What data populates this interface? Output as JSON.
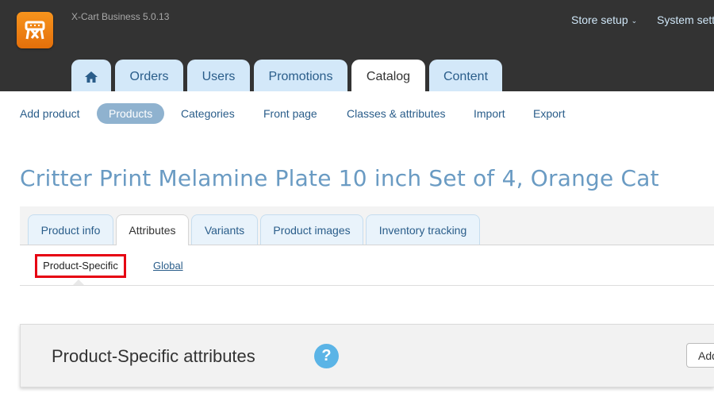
{
  "app": {
    "title": "X-Cart Business 5.0.13",
    "top_menu": [
      {
        "label": "Store setup"
      },
      {
        "label": "System sett"
      }
    ]
  },
  "main_tabs": [
    {
      "label": "",
      "icon": "home-icon"
    },
    {
      "label": "Orders"
    },
    {
      "label": "Users"
    },
    {
      "label": "Promotions"
    },
    {
      "label": "Catalog",
      "active": true
    },
    {
      "label": "Content"
    }
  ],
  "subnav": [
    {
      "label": "Add product"
    },
    {
      "label": "Products",
      "active": true
    },
    {
      "label": "Categories"
    },
    {
      "label": "Front page"
    },
    {
      "label": "Classes & attributes"
    },
    {
      "label": "Import"
    },
    {
      "label": "Export"
    }
  ],
  "page": {
    "title": "Critter Print Melamine Plate 10 inch Set of 4, Orange Cat"
  },
  "product_tabs": [
    {
      "label": "Product info"
    },
    {
      "label": "Attributes",
      "active": true
    },
    {
      "label": "Variants"
    },
    {
      "label": "Product images"
    },
    {
      "label": "Inventory tracking"
    }
  ],
  "attribute_subtabs": [
    {
      "label": "Product-Specific",
      "active": true
    },
    {
      "label": "Global"
    }
  ],
  "panel": {
    "title": "Product-Specific attributes",
    "help_label": "?",
    "add_button": "Add"
  },
  "colors": {
    "header_bg": "#333333",
    "tab_bg": "#d3e8f9",
    "link": "#2a5d8a",
    "title": "#6a9bc3",
    "highlight": "#e60012",
    "logo": "#f7941d"
  }
}
